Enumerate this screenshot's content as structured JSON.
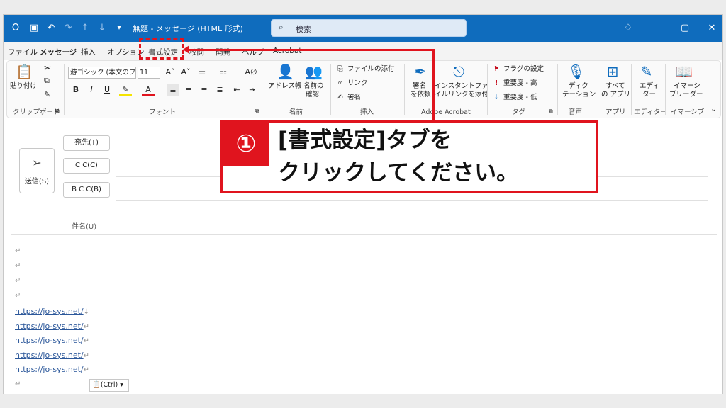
{
  "titlebar": {
    "title": "無題 - メッセージ (HTML 形式)",
    "search_placeholder": "検索",
    "icons": [
      "outlook-icon",
      "save-icon",
      "undo-icon",
      "redo-icon",
      "up-icon",
      "down-icon",
      "customize-icon"
    ]
  },
  "tabs": [
    "ファイル",
    "メッセージ",
    "挿入",
    "オプション",
    "書式設定",
    "校閲",
    "開発",
    "ヘルプ",
    "Acrobat"
  ],
  "ribbon": {
    "clipboard": {
      "paste": "貼り付け",
      "group": "クリップボード"
    },
    "font": {
      "font_name": "游ゴシック (本文のフォ",
      "font_size": "11",
      "group": "フォント"
    },
    "names": {
      "address_book": "アドレス帳",
      "check_names_1": "名前の",
      "check_names_2": "確認",
      "group": "名前"
    },
    "insert": {
      "attach": "ファイルの添付",
      "link": "リンク",
      "signature": "署名",
      "group": "挿入"
    },
    "acrobat": {
      "sign_1": "署名",
      "sign_2": "を依頼",
      "instant_1": "インスタントファ",
      "instant_2": "イルリンクを添付",
      "group": "Adobe Acrobat"
    },
    "tags": {
      "flag": "フラグの設定",
      "high": "重要度 - 高",
      "low": "重要度 - 低",
      "group": "タグ"
    },
    "voice": {
      "dictate_1": "ディク",
      "dictate_2": "テーション",
      "group": "音声"
    },
    "apps": {
      "all_1": "すべて",
      "all_2": "の アプリ",
      "group": "アプリ"
    },
    "editor": {
      "editor_1": "エディ",
      "editor_2": "ター",
      "group": "エディター"
    },
    "immersive": {
      "reader_1": "イマーシ",
      "reader_2": "ブリーダー",
      "group": "イマーシブ"
    }
  },
  "compose": {
    "send": "送信(S)",
    "to": "宛先(T)",
    "cc": "C C(C)",
    "bcc": "B C C(B)",
    "subject": "件名(U)",
    "paragraph_mark": "↵",
    "line_break_mark": "↓",
    "link_text": "https://jo-sys.net/",
    "paste_options": "(Ctrl)"
  },
  "callout": {
    "number": "①",
    "line1": "[書式設定]タブを",
    "line2": "クリックしてください。"
  }
}
